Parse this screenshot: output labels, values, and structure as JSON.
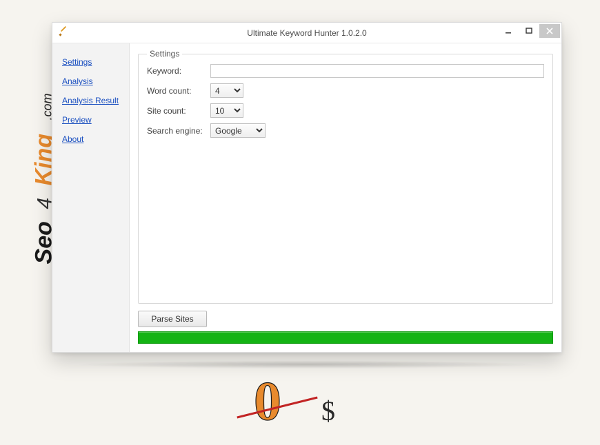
{
  "window": {
    "title": "Ultimate Keyword Hunter 1.0.2.0"
  },
  "sidebar": {
    "items": [
      {
        "label": "Settings"
      },
      {
        "label": "Analysis"
      },
      {
        "label": "Analysis Result"
      },
      {
        "label": "Preview"
      },
      {
        "label": "About"
      }
    ]
  },
  "settings": {
    "legend": "Settings",
    "keyword_label": "Keyword:",
    "keyword_value": "",
    "word_count_label": "Word count:",
    "word_count_value": "4",
    "site_count_label": "Site count:",
    "site_count_value": "10",
    "search_engine_label": "Search engine:",
    "search_engine_value": "Google"
  },
  "actions": {
    "parse_label": "Parse Sites"
  },
  "watermark": {
    "seo": "Seo",
    "four": "4",
    "king": "King",
    "com": ".com"
  },
  "price": {
    "zero": "0",
    "currency": "$"
  }
}
